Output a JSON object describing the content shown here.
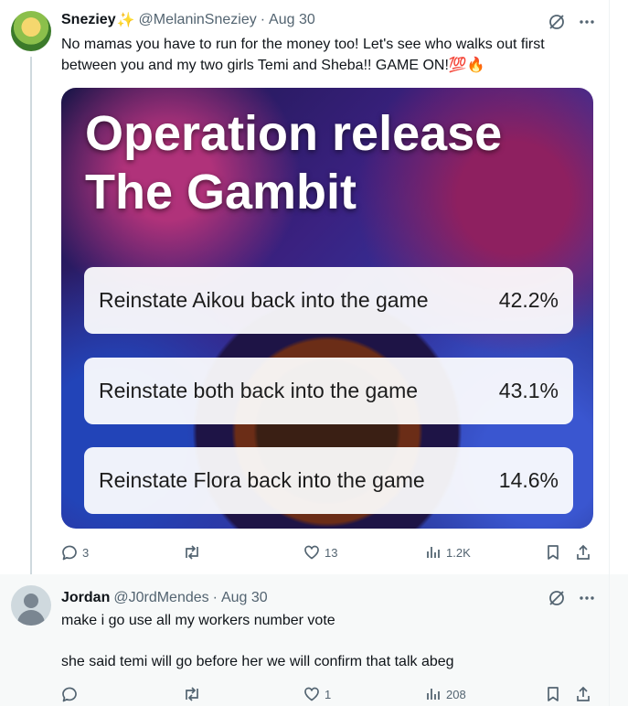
{
  "tweets": [
    {
      "author_name": "Sneziey",
      "author_emoji": "✨",
      "handle": "@MelaninSneziey",
      "separator": "·",
      "date": "Aug 30",
      "text_line1": "No mamas you have to run for the money too! Let's see who walks out first",
      "text_line2": "between you and my two girls Temi and Sheba!! GAME ON!💯🔥",
      "media": {
        "title_line1": "Operation release",
        "title_line2": "The Gambit",
        "options": [
          {
            "label": "Reinstate Aikou back into the game",
            "percent": "42.2%"
          },
          {
            "label": "Reinstate both back into the game",
            "percent": "43.1%"
          },
          {
            "label": "Reinstate Flora back into the game",
            "percent": "14.6%"
          }
        ]
      },
      "stats": {
        "replies": "3",
        "reposts": "",
        "likes": "13",
        "views": "1.2K"
      }
    },
    {
      "author_name": "Jordan",
      "handle": "@J0rdMendes",
      "separator": "·",
      "date": "Aug 30",
      "text_line1": "make i go use all my workers number vote",
      "text_line2": "she said temi will go before her we will confirm that talk abeg",
      "stats": {
        "replies": "",
        "reposts": "",
        "likes": "1",
        "views": "208"
      }
    }
  ],
  "colors": {
    "text": "#0f1419",
    "secondary": "#536471",
    "thread_line": "#cfd9de"
  }
}
